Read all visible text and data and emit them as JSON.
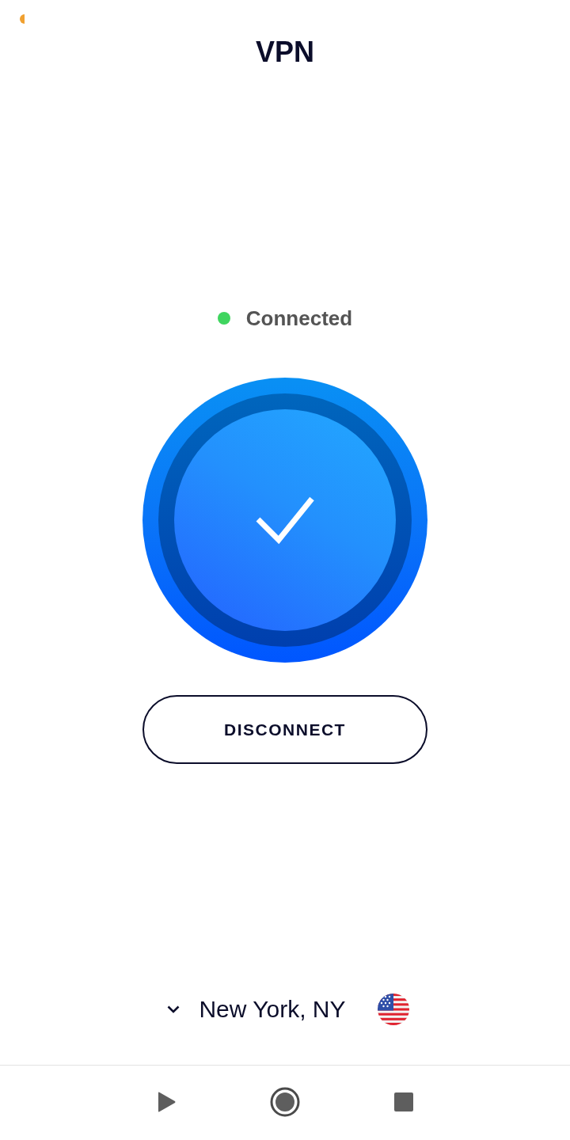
{
  "title": "VPN",
  "status": {
    "label": "Connected",
    "connected": true
  },
  "connect_button": {
    "label": "DISCONNECT"
  },
  "location": {
    "name": "New York, NY"
  },
  "media_controls": [
    {
      "kind": "play"
    },
    {
      "kind": "record"
    },
    {
      "kind": "stop"
    }
  ]
}
